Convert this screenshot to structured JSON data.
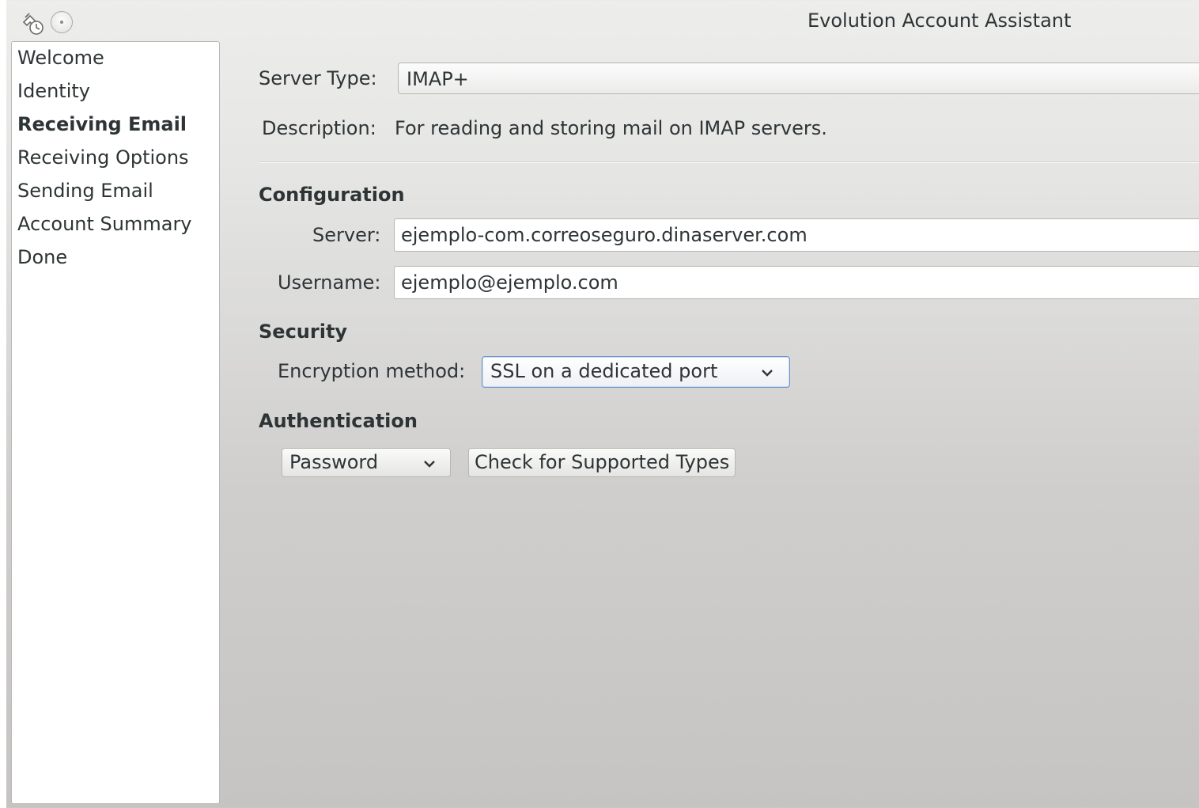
{
  "window": {
    "title": "Evolution Account Assistant"
  },
  "sidebar": {
    "steps": [
      {
        "label": "Welcome",
        "active": false
      },
      {
        "label": "Identity",
        "active": false
      },
      {
        "label": "Receiving Email",
        "active": true
      },
      {
        "label": "Receiving Options",
        "active": false
      },
      {
        "label": "Sending Email",
        "active": false
      },
      {
        "label": "Account Summary",
        "active": false
      },
      {
        "label": "Done",
        "active": false
      }
    ]
  },
  "receiving": {
    "server_type_label": "Server Type:",
    "server_type_value": "IMAP+",
    "description_label": "Description:",
    "description_value": "For reading and storing mail on IMAP servers."
  },
  "configuration": {
    "heading": "Configuration",
    "server_label": "Server:",
    "server_value": "ejemplo-com.correoseguro.dinaserver.com",
    "username_label": "Username:",
    "username_value": "ejemplo@ejemplo.com"
  },
  "security": {
    "heading": "Security",
    "encryption_label": "Encryption method:",
    "encryption_value": "SSL on a dedicated port"
  },
  "authentication": {
    "heading": "Authentication",
    "method_value": "Password",
    "check_button_label": "Check for Supported Types"
  },
  "icons": {
    "app": "evolution-settings-icon",
    "window_menu": "window-menu-dot-icon",
    "dropdown": "chevron-down-icon"
  },
  "colors": {
    "focus_border": "#6f95c7",
    "text": "#2e3436"
  }
}
